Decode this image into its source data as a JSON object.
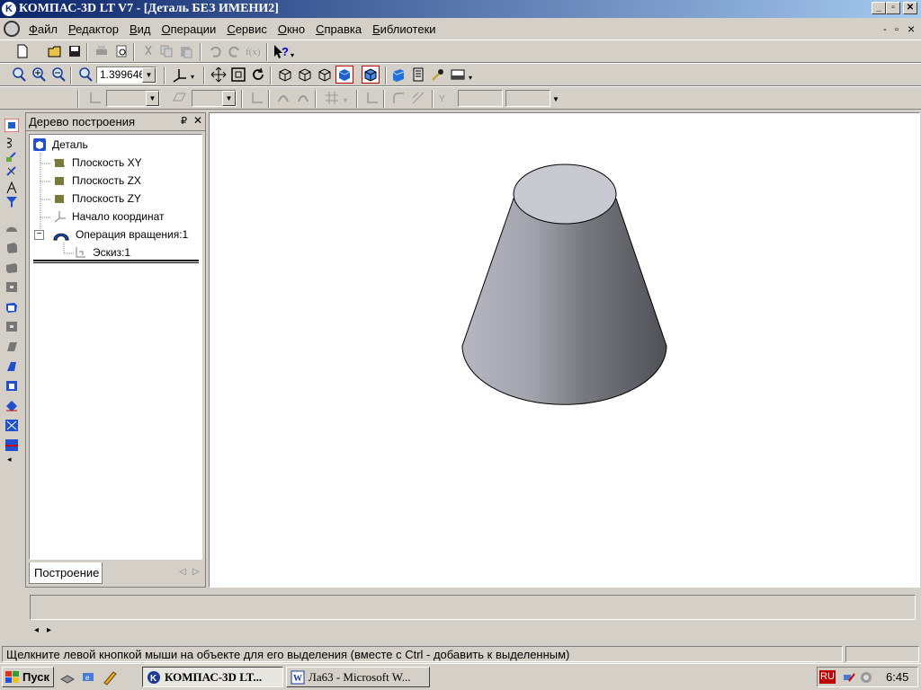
{
  "titlebar": {
    "title": "КОМПАС-3D LT V7 - [Деталь БЕЗ ИМЕНИ2]",
    "min": "_",
    "restore": "▫",
    "close": "✕"
  },
  "menu": [
    "Файл",
    "Редактор",
    "Вид",
    "Операции",
    "Сервис",
    "Окно",
    "Справка",
    "Библиотеки"
  ],
  "menu_underline": [
    "Ф",
    "Р",
    "В",
    "О",
    "С",
    "О",
    "С",
    "Б"
  ],
  "mdi": {
    "min": "-",
    "restore": "▫",
    "close": "×"
  },
  "zoom": {
    "value": "1.399646"
  },
  "tree": {
    "title": "Дерево построения",
    "pin": "₽",
    "close": "✕",
    "items": [
      {
        "label": "Деталь",
        "icon": "part-icon"
      },
      {
        "label": "Плоскость XY",
        "icon": "plane-icon"
      },
      {
        "label": "Плоскость ZX",
        "icon": "plane-icon"
      },
      {
        "label": "Плоскость ZY",
        "icon": "plane-icon"
      },
      {
        "label": "Начало координат",
        "icon": "origin-icon"
      },
      {
        "label": "Операция вращения:1",
        "icon": "rotation-op-icon"
      },
      {
        "label": "Эскиз:1",
        "icon": "sketch-icon"
      }
    ],
    "tab": "Построение",
    "expander": "−"
  },
  "status": {
    "text": "Щелкните левой кнопкой мыши на объекте для его выделения (вместе с Ctrl - добавить к выделенным)"
  },
  "taskbar": {
    "start": "Пуск",
    "tasks": [
      {
        "label": "КОМПАС-3D LT...",
        "active": true
      },
      {
        "label": "Ла63 - Microsoft W...",
        "active": false
      }
    ],
    "lang": "RU",
    "clock": "6:45"
  },
  "colors": {
    "title_start": "#0a246a",
    "title_end": "#a6caf0",
    "chrome": "#d4d0c8",
    "cone_light": "#b4b4c0",
    "cone_dark": "#55575c"
  }
}
